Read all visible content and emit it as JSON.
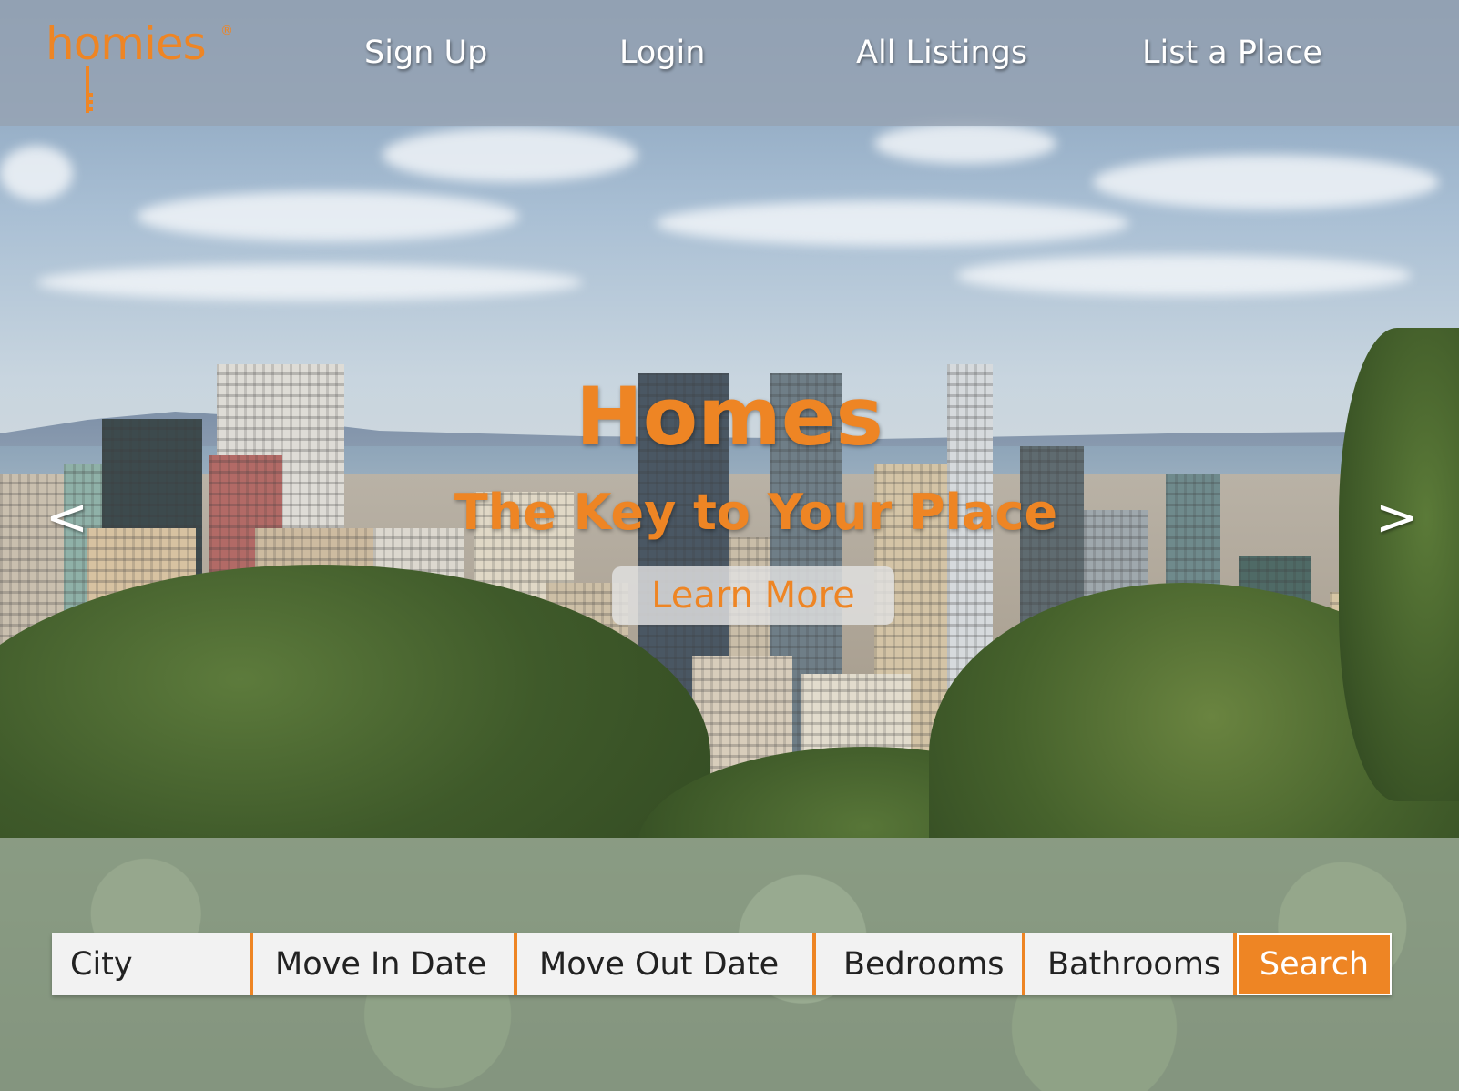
{
  "brand": {
    "name": "homies",
    "registered": "®",
    "accent": "#ee8524"
  },
  "nav": {
    "items": [
      {
        "label": "Sign Up"
      },
      {
        "label": "Login"
      },
      {
        "label": "All Listings"
      },
      {
        "label": "List a Place"
      }
    ]
  },
  "hero": {
    "title": "Homes",
    "subtitle": "The Key to Your Place",
    "cta_label": "Learn More",
    "prev_icon": "<",
    "next_icon": ">"
  },
  "search": {
    "fields": [
      {
        "label": "City"
      },
      {
        "label": "Move In Date"
      },
      {
        "label": "Move Out Date"
      },
      {
        "label": "Bedrooms"
      },
      {
        "label": "Bathrooms"
      }
    ],
    "button_label": "Search"
  }
}
